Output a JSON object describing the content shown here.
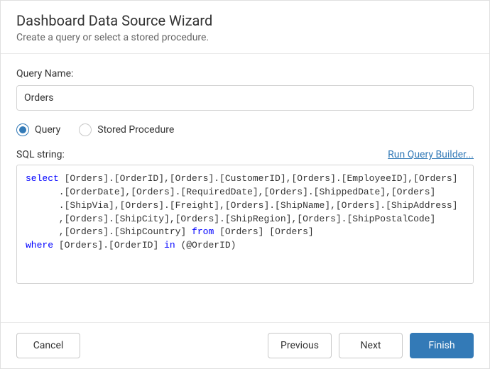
{
  "header": {
    "title": "Dashboard Data Source Wizard",
    "subtitle": "Create a query or select a stored procedure."
  },
  "queryName": {
    "label": "Query Name:",
    "value": "Orders"
  },
  "typeRadios": {
    "query": "Query",
    "storedProcedure": "Stored Procedure",
    "selected": "query"
  },
  "sql": {
    "label": "SQL string:",
    "runQueryBuilder": "Run Query Builder...",
    "tokens": [
      {
        "t": "kw",
        "v": "select"
      },
      {
        "t": "tx",
        "v": " [Orders].[OrderID],[Orders].[CustomerID],[Orders].[EmployeeID],[Orders]\n      .[OrderDate],[Orders].[RequiredDate],[Orders].[ShippedDate],[Orders]\n      .[ShipVia],[Orders].[Freight],[Orders].[ShipName],[Orders].[ShipAddress]\n      ,[Orders].[ShipCity],[Orders].[ShipRegion],[Orders].[ShipPostalCode]\n      ,[Orders].[ShipCountry] "
      },
      {
        "t": "kw",
        "v": "from"
      },
      {
        "t": "tx",
        "v": " [Orders] [Orders]\n"
      },
      {
        "t": "kw",
        "v": "where"
      },
      {
        "t": "tx",
        "v": " [Orders].[OrderID] "
      },
      {
        "t": "kw",
        "v": "in"
      },
      {
        "t": "tx",
        "v": " (@OrderID)"
      }
    ]
  },
  "footer": {
    "cancel": "Cancel",
    "previous": "Previous",
    "next": "Next",
    "finish": "Finish"
  }
}
